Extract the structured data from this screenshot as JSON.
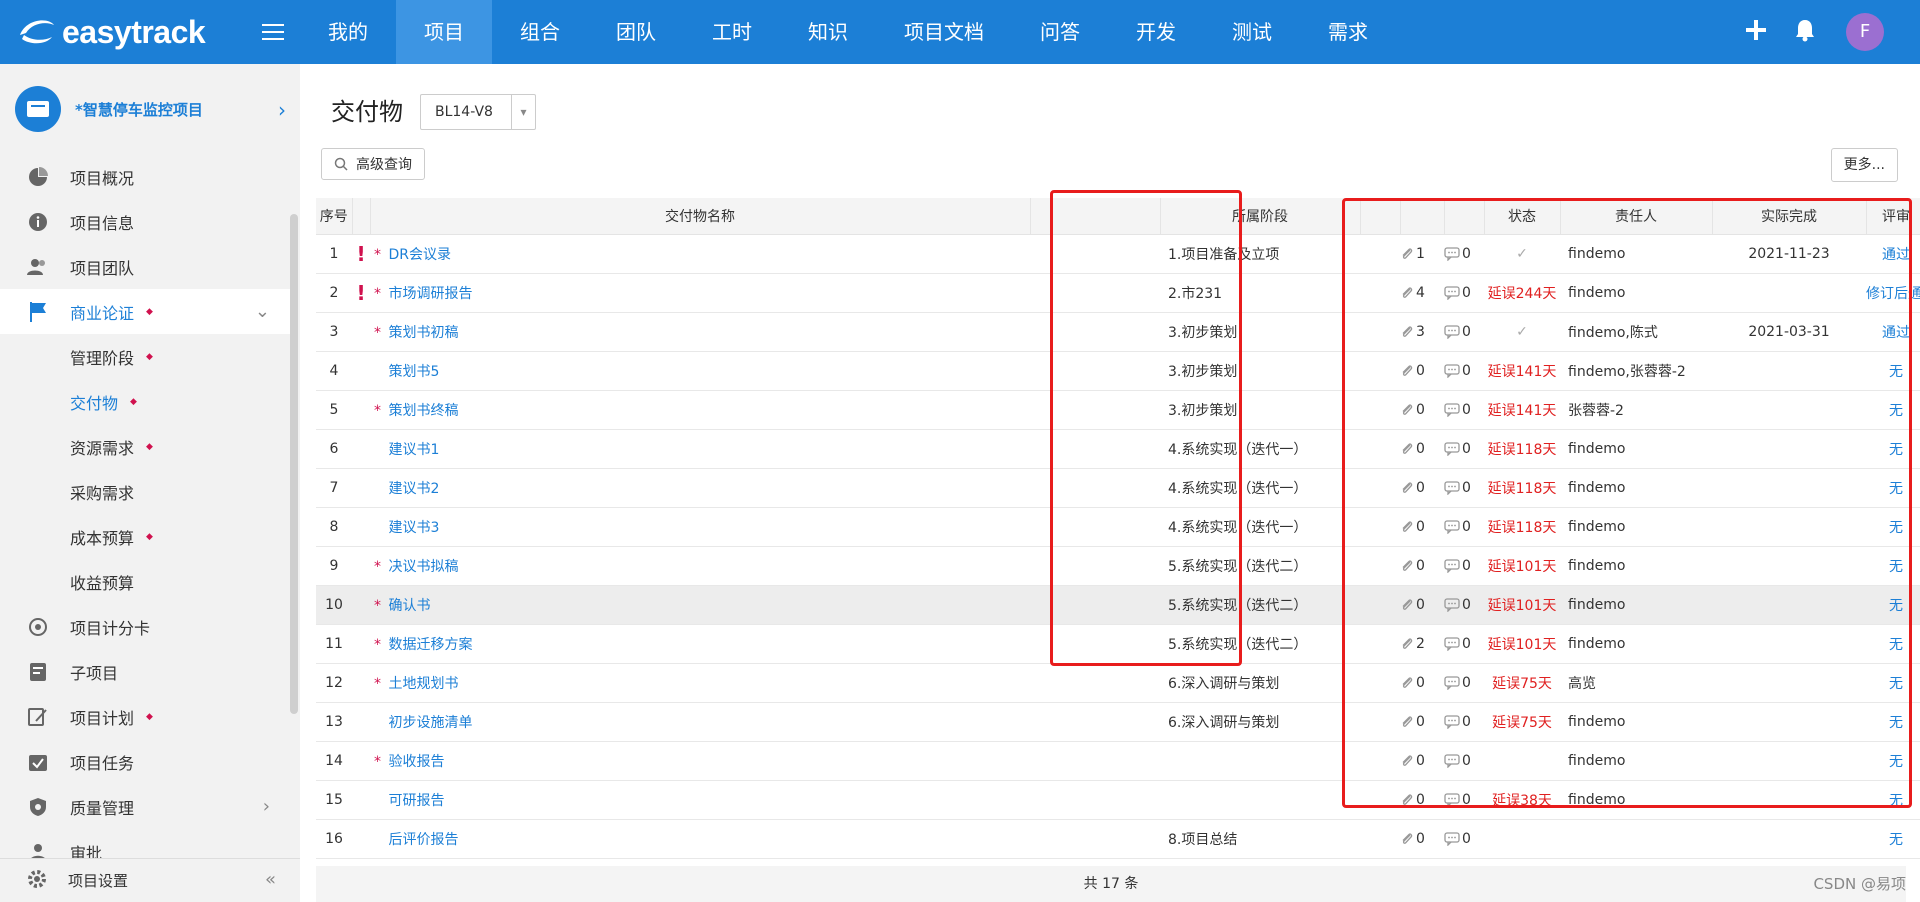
{
  "app": {
    "logo_text": "easytrack"
  },
  "nav": [
    "我的",
    "项目",
    "组合",
    "团队",
    "工时",
    "知识",
    "项目文档",
    "问答",
    "开发",
    "测试",
    "需求"
  ],
  "user": {
    "avatar_letter": "F"
  },
  "sidebar": {
    "project_name": "*智慧停车监控项目",
    "items": [
      {
        "label": "项目概况",
        "icon": "pie-chart-icon"
      },
      {
        "label": "项目信息",
        "icon": "info-icon"
      },
      {
        "label": "项目团队",
        "icon": "team-icon"
      },
      {
        "label": "商业论证",
        "icon": "flag-icon"
      }
    ],
    "subitems": [
      {
        "label": "管理阶段"
      },
      {
        "label": "交付物"
      },
      {
        "label": "资源需求"
      },
      {
        "label": "采购需求"
      },
      {
        "label": "成本预算"
      },
      {
        "label": "收益预算"
      }
    ],
    "items2": [
      {
        "label": "项目计分卡",
        "icon": "target-icon"
      },
      {
        "label": "子项目",
        "icon": "subproject-icon"
      },
      {
        "label": "项目计划",
        "icon": "plan-icon"
      },
      {
        "label": "项目任务",
        "icon": "task-icon"
      },
      {
        "label": "质量管理",
        "icon": "shield-icon"
      },
      {
        "label": "审批",
        "icon": "user-icon"
      }
    ],
    "settings_label": "项目设置"
  },
  "page": {
    "title": "交付物",
    "version": "BL14-V8",
    "advanced_search": "高级查询",
    "more_button": "更多..."
  },
  "table": {
    "headers": {
      "no": "序号",
      "name": "交付物名称",
      "stage": "所属阶段",
      "status": "状态",
      "owner": "责任人",
      "done": "实际完成",
      "review": "评审"
    },
    "rows": [
      {
        "no": "1",
        "bang": "!",
        "req": "*",
        "name": "DR会议录",
        "stage": "1.项目准备及立项",
        "att": "1",
        "cmt": "0",
        "status": "✓",
        "owner": "findemo",
        "done": "2021-11-23",
        "review": "通过"
      },
      {
        "no": "2",
        "bang": "!",
        "req": "*",
        "name": "市场调研报告",
        "stage": "2.市231",
        "att": "4",
        "cmt": "0",
        "status": "延误244天",
        "owner": "findemo",
        "done": "",
        "review": "修订后通过"
      },
      {
        "no": "3",
        "bang": "",
        "req": "*",
        "name": "策划书初稿",
        "stage": "3.初步策划",
        "att": "3",
        "cmt": "0",
        "status": "✓",
        "owner": "findemo,陈式",
        "done": "2021-03-31",
        "review": "通过"
      },
      {
        "no": "4",
        "bang": "",
        "req": "",
        "name": "策划书5",
        "stage": "3.初步策划",
        "att": "0",
        "cmt": "0",
        "status": "延误141天",
        "owner": "findemo,张蓉蓉-2",
        "done": "",
        "review": "无"
      },
      {
        "no": "5",
        "bang": "",
        "req": "*",
        "name": "策划书终稿",
        "stage": "3.初步策划",
        "att": "0",
        "cmt": "0",
        "status": "延误141天",
        "owner": "张蓉蓉-2",
        "done": "",
        "review": "无"
      },
      {
        "no": "6",
        "bang": "",
        "req": "",
        "name": "建议书1",
        "stage": "4.系统实现（迭代一）",
        "att": "0",
        "cmt": "0",
        "status": "延误118天",
        "owner": "findemo",
        "done": "",
        "review": "无"
      },
      {
        "no": "7",
        "bang": "",
        "req": "",
        "name": "建议书2",
        "stage": "4.系统实现（迭代一）",
        "att": "0",
        "cmt": "0",
        "status": "延误118天",
        "owner": "findemo",
        "done": "",
        "review": "无"
      },
      {
        "no": "8",
        "bang": "",
        "req": "",
        "name": "建议书3",
        "stage": "4.系统实现（迭代一）",
        "att": "0",
        "cmt": "0",
        "status": "延误118天",
        "owner": "findemo",
        "done": "",
        "review": "无"
      },
      {
        "no": "9",
        "bang": "",
        "req": "*",
        "name": "决议书拟稿",
        "stage": "5.系统实现（迭代二）",
        "att": "0",
        "cmt": "0",
        "status": "延误101天",
        "owner": "findemo",
        "done": "",
        "review": "无"
      },
      {
        "no": "10",
        "bang": "",
        "req": "*",
        "name": "确认书",
        "stage": "5.系统实现（迭代二）",
        "att": "0",
        "cmt": "0",
        "status": "延误101天",
        "owner": "findemo",
        "done": "",
        "review": "无"
      },
      {
        "no": "11",
        "bang": "",
        "req": "*",
        "name": "数据迁移方案",
        "stage": "5.系统实现（迭代二）",
        "att": "2",
        "cmt": "0",
        "status": "延误101天",
        "owner": "findemo",
        "done": "",
        "review": "无"
      },
      {
        "no": "12",
        "bang": "",
        "req": "*",
        "name": "土地规划书",
        "stage": "6.深入调研与策划",
        "att": "0",
        "cmt": "0",
        "status": "延误75天",
        "owner": "高览",
        "done": "",
        "review": "无"
      },
      {
        "no": "13",
        "bang": "",
        "req": "",
        "name": "初步设施清单",
        "stage": "6.深入调研与策划",
        "att": "0",
        "cmt": "0",
        "status": "延误75天",
        "owner": "findemo",
        "done": "",
        "review": "无"
      },
      {
        "no": "14",
        "bang": "",
        "req": "*",
        "name": "验收报告",
        "stage": "",
        "att": "0",
        "cmt": "0",
        "status": "",
        "owner": "findemo",
        "done": "",
        "review": "无"
      },
      {
        "no": "15",
        "bang": "",
        "req": "",
        "name": "可研报告",
        "stage": "",
        "att": "0",
        "cmt": "0",
        "status": "延误38天",
        "owner": "findemo",
        "done": "",
        "review": "无"
      },
      {
        "no": "16",
        "bang": "",
        "req": "",
        "name": "后评价报告",
        "stage": "8.项目总结",
        "att": "0",
        "cmt": "0",
        "status": "",
        "owner": "",
        "done": "",
        "review": "无"
      }
    ],
    "footer": "共 17 条"
  },
  "watermark": "CSDN @易项"
}
